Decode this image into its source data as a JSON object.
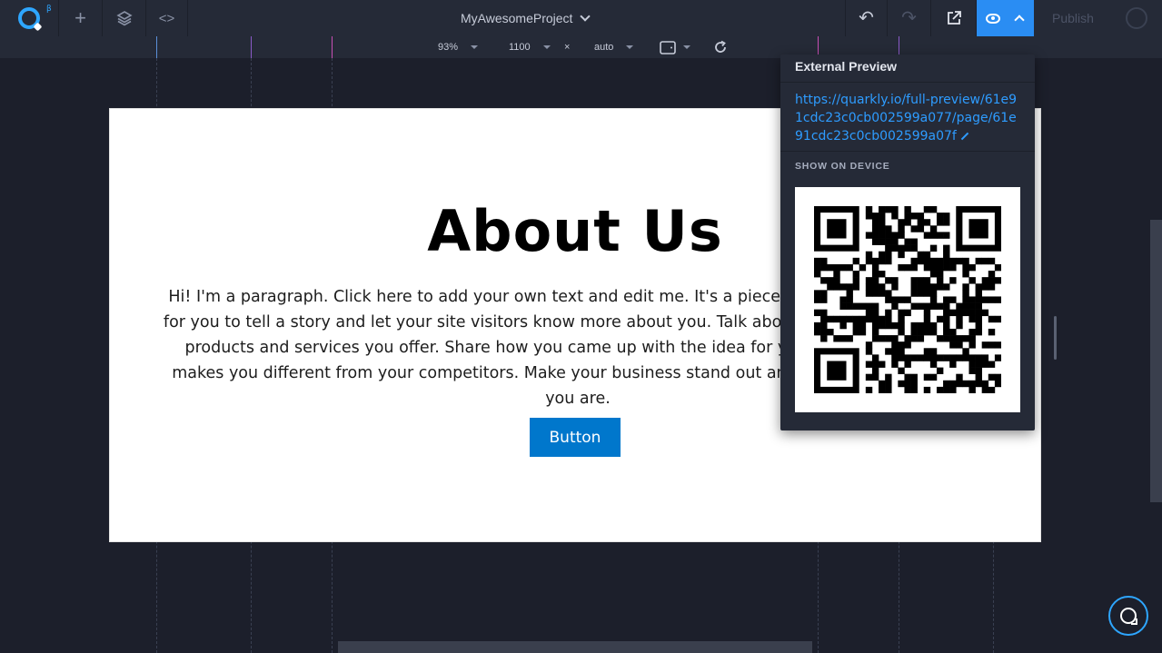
{
  "topbar": {
    "beta": "β",
    "add_icon": "+",
    "code_icon": "<>",
    "project_name": "MyAwesomeProject",
    "undo_icon": "↶",
    "redo_icon": "↷",
    "external_icon": "⇱",
    "publish_label": "Publish"
  },
  "subbar": {
    "zoom": "93%",
    "width": "1100",
    "times": "×",
    "height": "auto"
  },
  "canvas": {
    "heading": "About Us",
    "paragraph": "Hi! I'm a paragraph. Click here to add your own text and edit me. It's a piece of cake. I'm a great place for you to tell a story and let your site visitors know more about you. Talk about your business and what products and services you offer. Share how you came up with the idea for your company and what makes you different from your competitors. Make your business stand out and show your visitors who you are.",
    "button_label": "Button"
  },
  "preview_popover": {
    "title": "External Preview",
    "url": "https://quarkly.io/full-preview/61e91cdc23c0cb002599a077/page/61e91cdc23c0cb002599a07f",
    "device_label": "SHOW ON DEVICE"
  },
  "colors": {
    "accent": "#2a8df3",
    "topbar_bg": "#252a37",
    "workspace_bg": "#1c1f2b",
    "link": "#2e9cff",
    "cta": "#0077cc"
  },
  "icons": [
    "quarkly-logo-icon",
    "add-icon",
    "layers-icon",
    "code-icon",
    "chevron-down-icon",
    "undo-icon",
    "redo-icon",
    "external-link-icon",
    "eye-icon",
    "chevron-up-icon",
    "avatar-icon",
    "device-icon",
    "refresh-icon",
    "pencil-icon",
    "chat-icon"
  ]
}
